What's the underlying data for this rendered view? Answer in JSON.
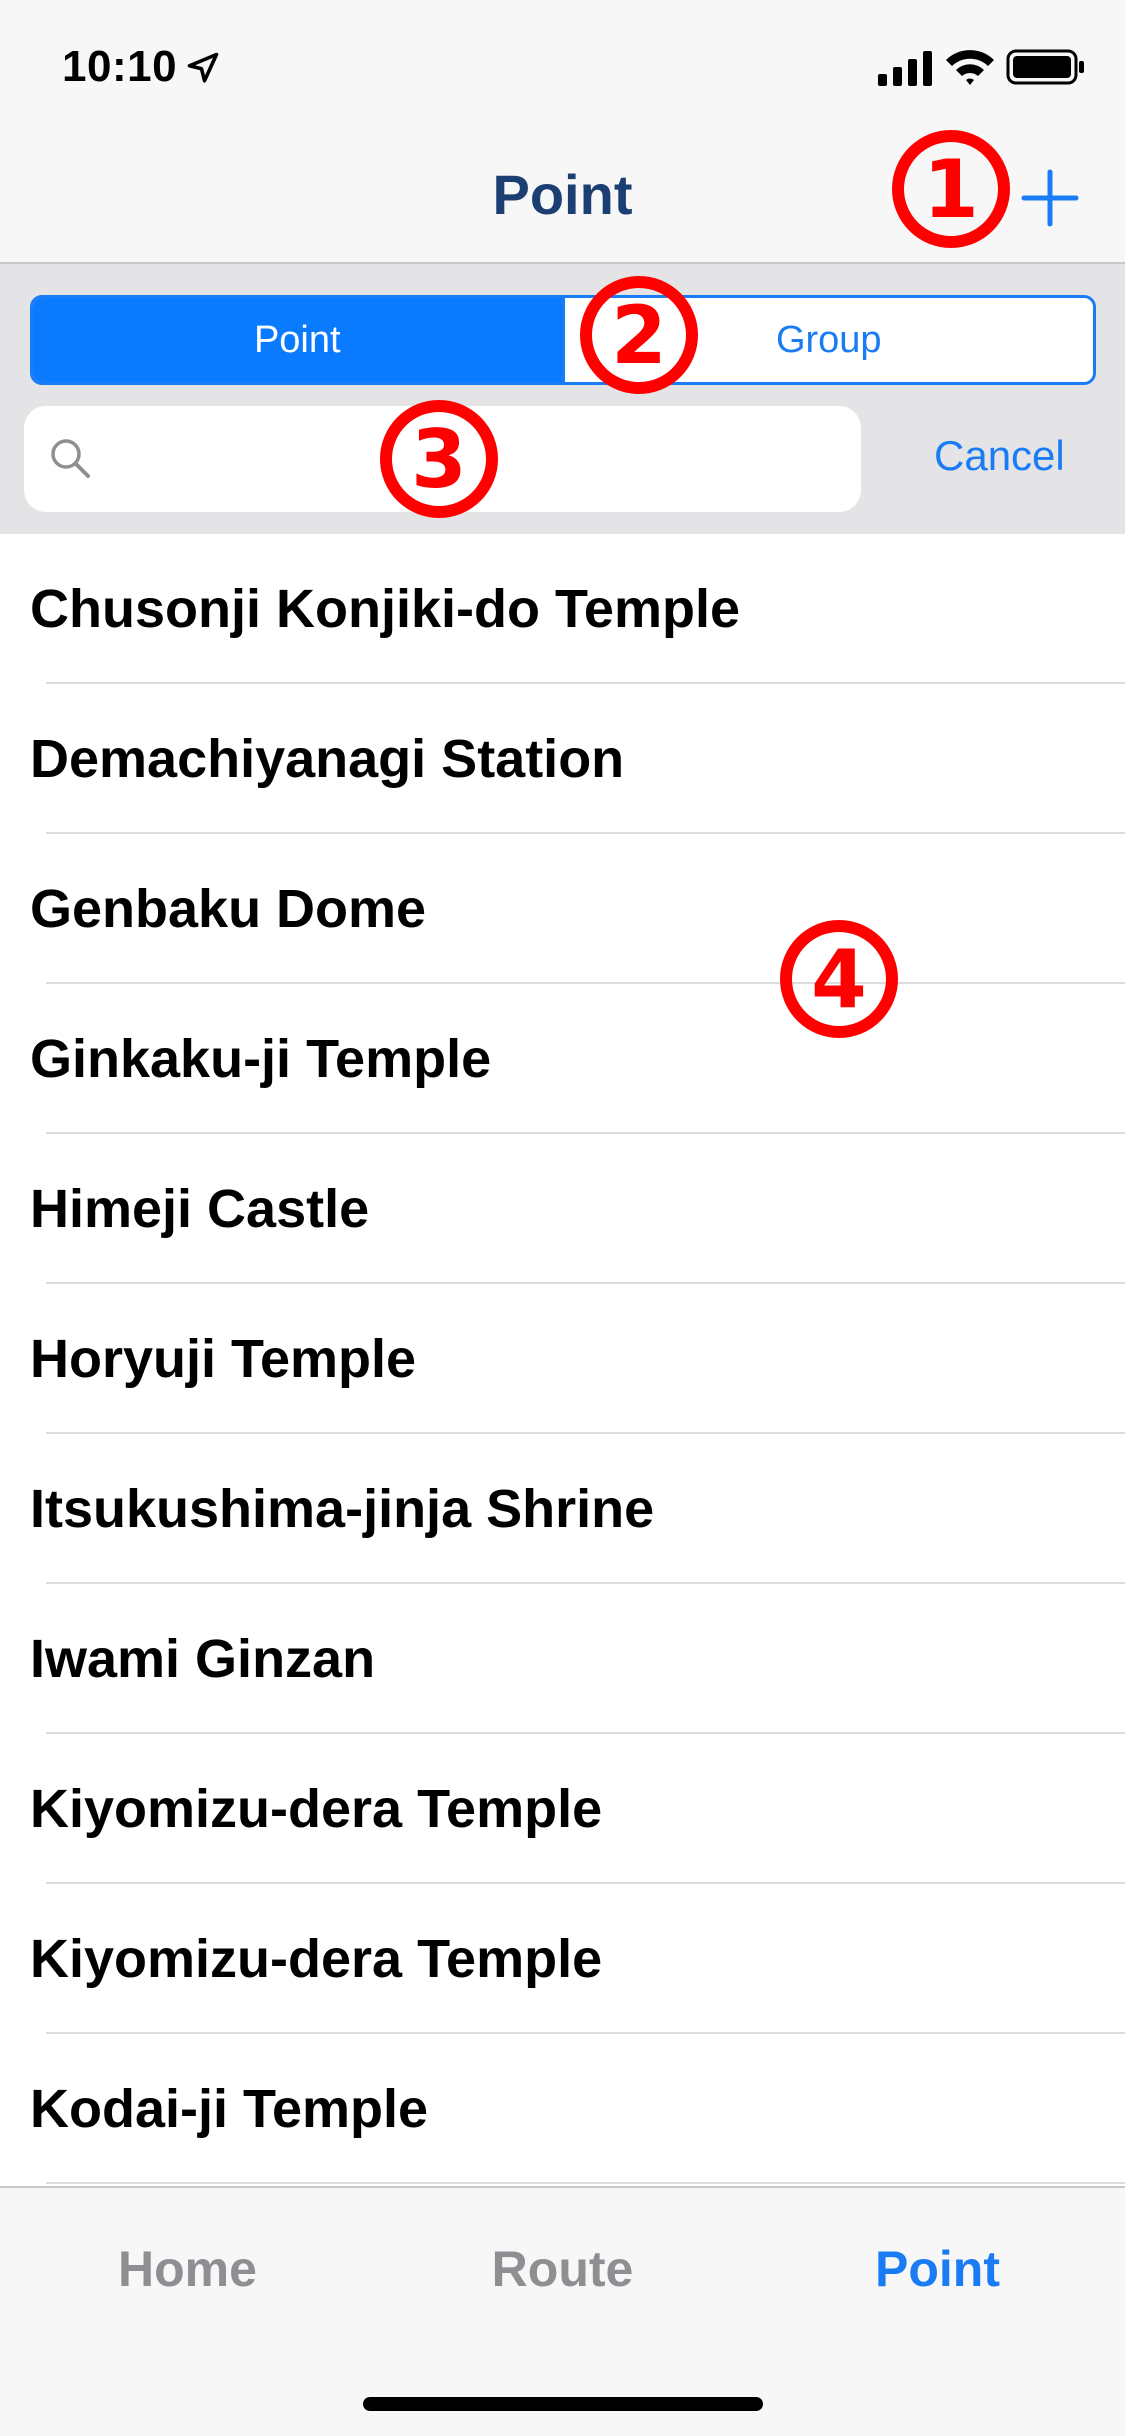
{
  "status_bar": {
    "time": "10:10"
  },
  "nav": {
    "title": "Point",
    "add_label": "+"
  },
  "segmented": {
    "point_label": "Point",
    "group_label": "Group"
  },
  "search": {
    "placeholder": "",
    "value": "",
    "cancel_label": "Cancel"
  },
  "list": {
    "items": [
      {
        "label": "Chusonji Konjiki-do Temple"
      },
      {
        "label": "Demachiyanagi Station"
      },
      {
        "label": "Genbaku Dome"
      },
      {
        "label": "Ginkaku-ji Temple"
      },
      {
        "label": "Himeji Castle"
      },
      {
        "label": "Horyuji Temple"
      },
      {
        "label": "Itsukushima-jinja Shrine"
      },
      {
        "label": "Iwami Ginzan"
      },
      {
        "label": "Kiyomizu-dera Temple"
      },
      {
        "label": "Kiyomizu-dera Temple"
      },
      {
        "label": "Kodai-ji Temple"
      }
    ]
  },
  "tabs": [
    {
      "label": "Home",
      "active": false
    },
    {
      "label": "Route",
      "active": false
    },
    {
      "label": "Point",
      "active": true
    }
  ],
  "annotations": [
    {
      "number": "1"
    },
    {
      "number": "2"
    },
    {
      "number": "3"
    },
    {
      "number": "4"
    }
  ],
  "colors": {
    "accent": "#1a7cf4",
    "nav_title": "#1c3f73",
    "annotation": "#ff0000"
  }
}
